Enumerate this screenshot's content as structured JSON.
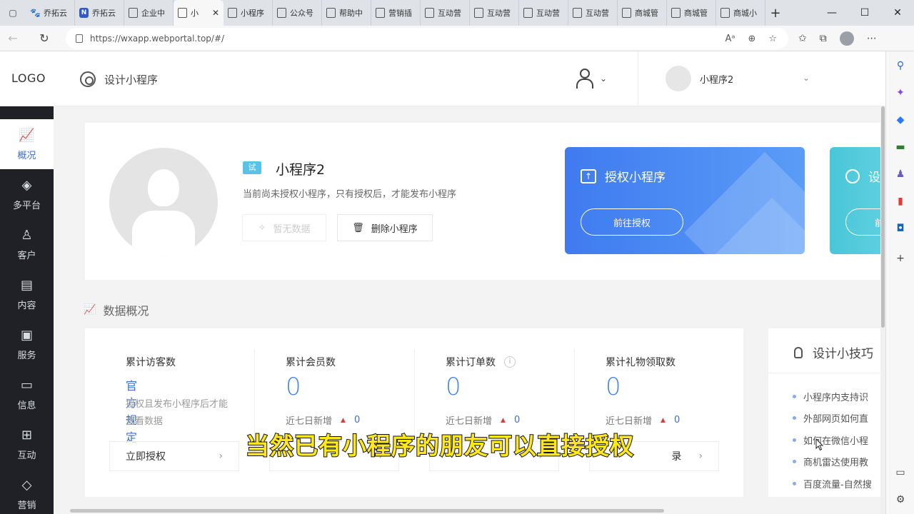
{
  "browser": {
    "tabs": [
      {
        "label": "乔拓云",
        "icon": "paw-icon"
      },
      {
        "label": "乔拓云",
        "icon": "n-logo-icon"
      },
      {
        "label": "企业中",
        "icon": "page-icon"
      },
      {
        "label": "小",
        "icon": "page-icon",
        "active": true
      },
      {
        "label": "小程序",
        "icon": "page-icon"
      },
      {
        "label": "公众号",
        "icon": "page-icon"
      },
      {
        "label": "帮助中",
        "icon": "page-icon"
      },
      {
        "label": "营销插",
        "icon": "page-icon"
      },
      {
        "label": "互动营",
        "icon": "page-icon"
      },
      {
        "label": "互动营",
        "icon": "page-icon"
      },
      {
        "label": "互动营",
        "icon": "page-icon"
      },
      {
        "label": "互动营",
        "icon": "page-icon"
      },
      {
        "label": "商城管",
        "icon": "page-icon"
      },
      {
        "label": "商城管",
        "icon": "page-icon"
      },
      {
        "label": "商城小",
        "icon": "page-icon"
      }
    ],
    "url": "https://wxapp.webportal.top/#/"
  },
  "header": {
    "logo": "LOGO",
    "design_link": "设计小程序",
    "account_name": "小程序2"
  },
  "sidebar": {
    "items": [
      {
        "label": "概况",
        "icon": "chart-icon",
        "active": true
      },
      {
        "label": "多平台",
        "icon": "layers-icon"
      },
      {
        "label": "客户",
        "icon": "user-icon"
      },
      {
        "label": "内容",
        "icon": "document-icon"
      },
      {
        "label": "服务",
        "icon": "service-icon"
      },
      {
        "label": "信息",
        "icon": "message-icon"
      },
      {
        "label": "互动",
        "icon": "interact-icon"
      },
      {
        "label": "营销",
        "icon": "tag-icon"
      }
    ]
  },
  "profile": {
    "trial_tag": "试",
    "name": "小程序2",
    "description": "当前尚未授权小程序，只有授权后，才能发布小程序",
    "btn_no_data": "暂无数据",
    "btn_delete": "删除小程序"
  },
  "auth_card": {
    "title": "授权小程序",
    "button": "前往授权",
    "color": "#3f7bef"
  },
  "design_card": {
    "title": "设",
    "button": "前",
    "color": "#49c6d8"
  },
  "overview": {
    "section_title": "数据概况",
    "stats": [
      {
        "label": "累计访客数",
        "link": "官方规定",
        "note": "授权且发布小程序后才能查看数据",
        "button": "立即授权"
      },
      {
        "label": "累计会员数",
        "value": "0",
        "week_label": "近七日新增",
        "week_value": "0"
      },
      {
        "label": "累计订单数",
        "value": "0",
        "week_label": "近七日新增",
        "week_value": "0"
      },
      {
        "label": "累计礼物领取数",
        "value": "0",
        "week_label": "近七日新增",
        "week_value": "0",
        "button_tail": "录"
      }
    ]
  },
  "tips": {
    "title": "设计小技巧",
    "items": [
      "小程序内支持识",
      "外部网页如何直",
      "如何在微信小程",
      "商机雷达使用教",
      "百度流量-自然搜"
    ]
  },
  "subtitle": "当然已有小程序的朋友可以直接授权"
}
